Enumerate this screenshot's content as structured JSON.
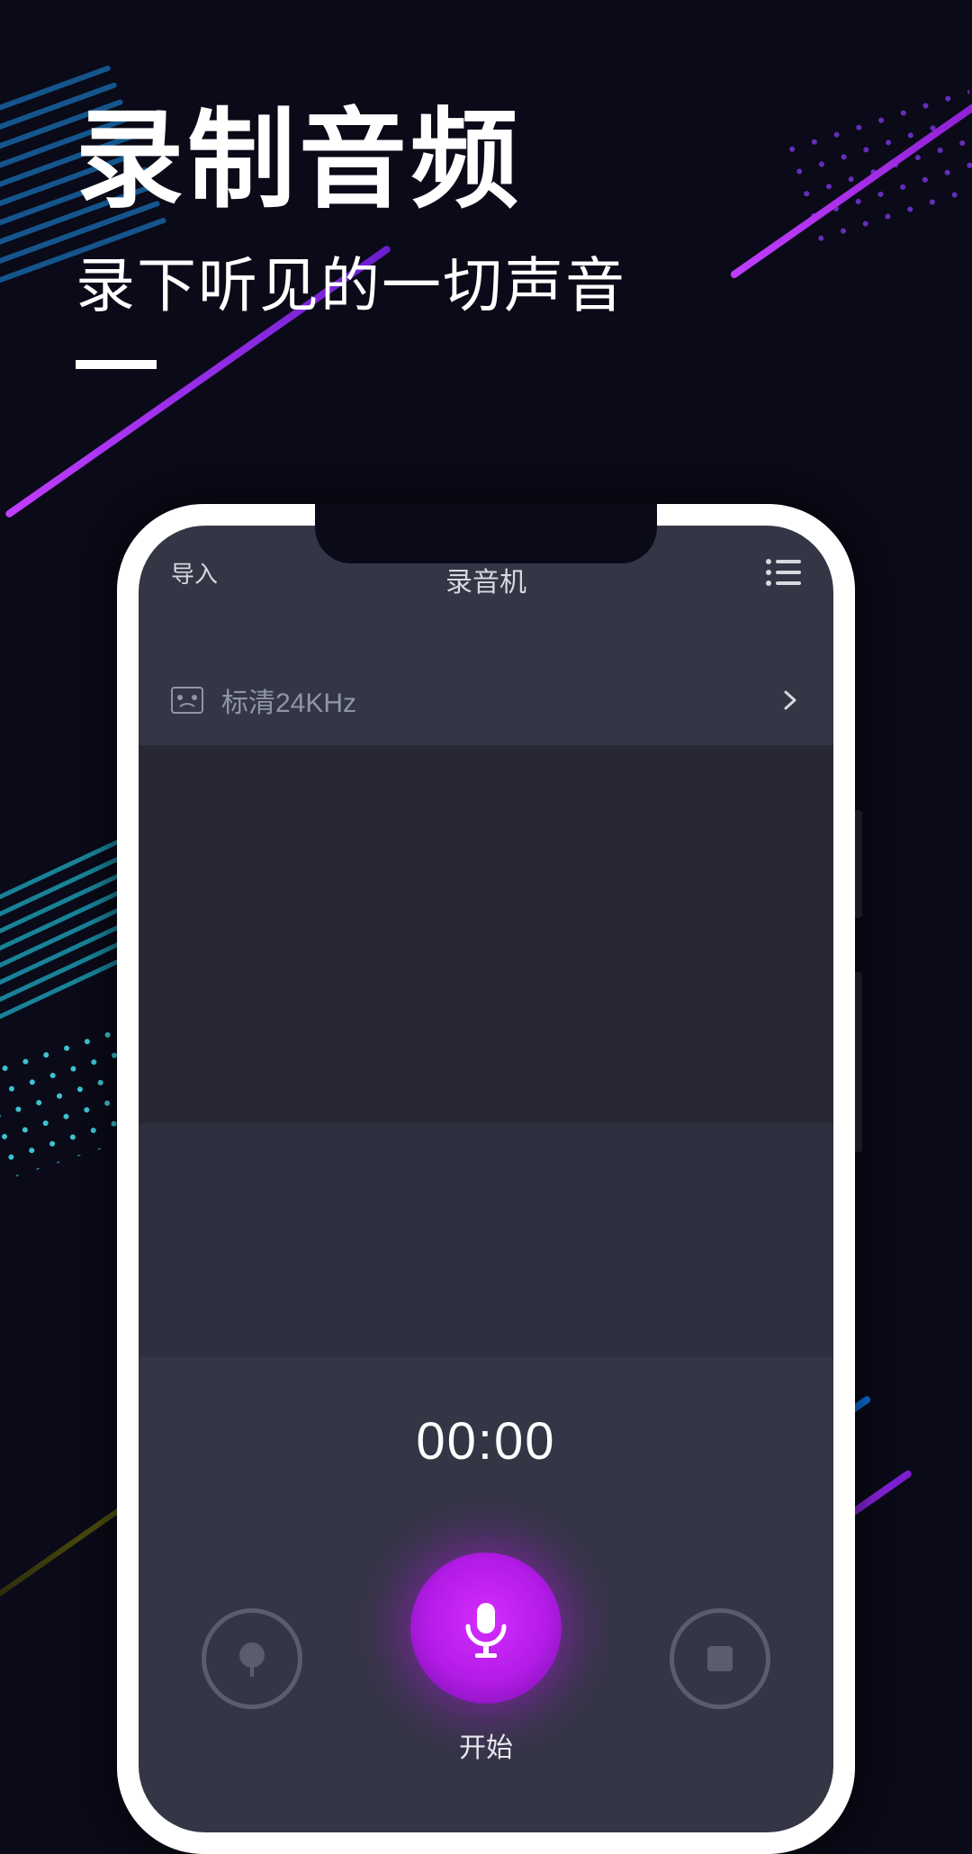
{
  "hero": {
    "title": "录制音频",
    "subtitle": "录下听见的一切声音"
  },
  "phone": {
    "topbar": {
      "import_label": "导入",
      "title": "录音机"
    },
    "quality": {
      "label": "标清24KHz"
    },
    "timer": "00:00",
    "record_label": "开始"
  }
}
